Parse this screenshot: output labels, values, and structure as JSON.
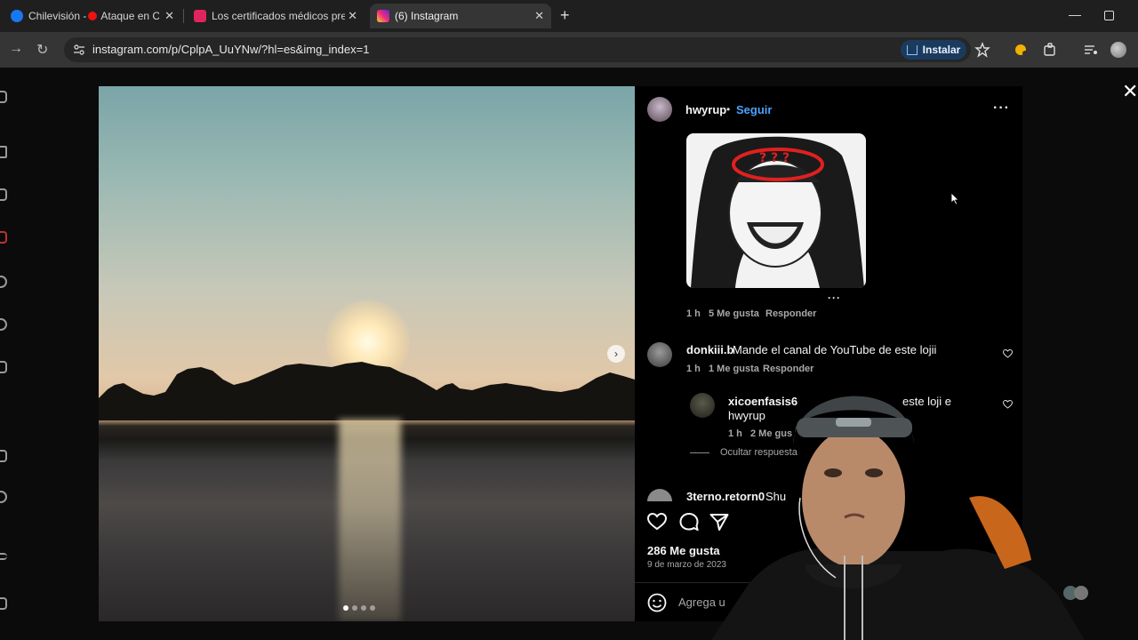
{
  "browser": {
    "tabs": [
      {
        "title": "Chilevisión - ",
        "subtitle": "Ataque en Cal",
        "active": false
      },
      {
        "title": "Los certificados médicos presen",
        "active": false
      },
      {
        "title": "(6) Instagram",
        "active": true
      }
    ],
    "url": "instagram.com/p/CplpA_UuYNw/?hl=es&img_index=1",
    "install_label": "Instalar"
  },
  "post": {
    "author": "hwyrup",
    "follow_label": "Seguir",
    "sticker_comment": {
      "time": "1 h",
      "likes": "5 Me gusta",
      "reply": "Responder"
    },
    "comments": [
      {
        "user": "donkiii.b",
        "text": "Mande el canal de YouTube de este lojii",
        "time": "1 h",
        "likes": "1 Me gusta",
        "reply": "Responder"
      },
      {
        "user": "xicoenfasis6",
        "text": "este loji e",
        "mention": "hwyrup",
        "time": "1 h",
        "likes": "2 Me gus",
        "hide_replies": "Ocultar respuesta"
      },
      {
        "user": "3terno.retorn0",
        "text": "Shu"
      }
    ],
    "likes": "286 Me gusta",
    "date": "9 de marzo de 2023",
    "add_comment_placeholder": "Agrega u"
  },
  "colors": {
    "accent": "#4aa3ff",
    "install_bg": "#1b3b5e"
  }
}
